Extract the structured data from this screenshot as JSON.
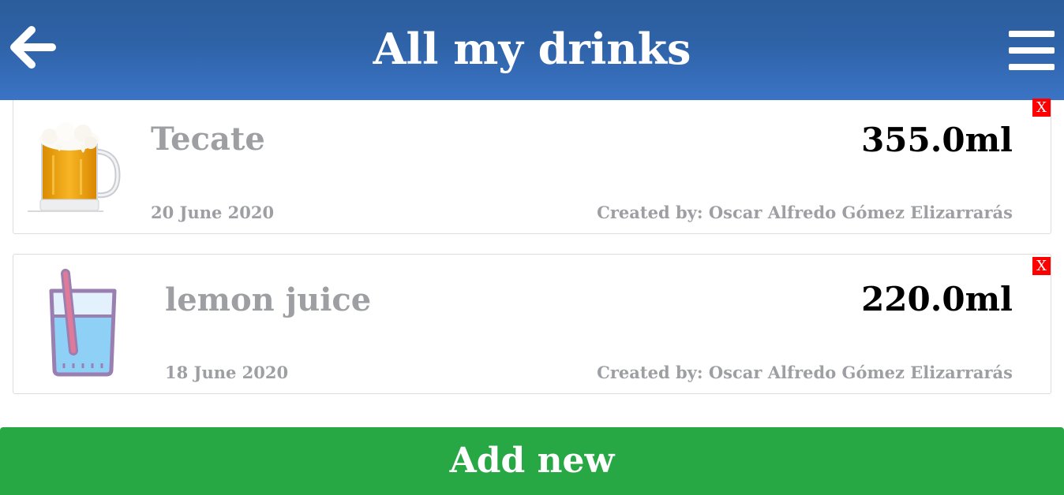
{
  "header": {
    "title": "All my drinks",
    "back_icon": "arrow-left-icon",
    "menu_icon": "hamburger-menu-icon",
    "background_color": "#2f63a8"
  },
  "drinks": [
    {
      "name": "Tecate",
      "amount": "355.0ml",
      "date": "20 June 2020",
      "creator": "Created by: Oscar Alfredo Gómez Elizarrarás",
      "image": "beer-mug-icon",
      "delete_label": "X"
    },
    {
      "name": "lemon juice",
      "amount": "220.0ml",
      "date": "18 June 2020",
      "creator": "Created by: Oscar Alfredo Gómez Elizarrarás",
      "image": "juice-glass-icon",
      "delete_label": "X"
    }
  ],
  "footer": {
    "add_label": "Add new",
    "color": "#28a745"
  },
  "colors": {
    "muted_text": "#9e9fa3",
    "delete_red": "#ff0000"
  }
}
